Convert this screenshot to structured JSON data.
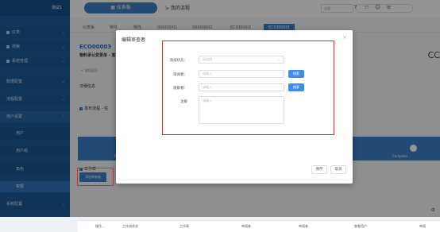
{
  "sidebar": {
    "brand": "测试1",
    "items": [
      {
        "label": "仪表",
        "type": "top"
      },
      {
        "label": "搜索",
        "type": "top"
      },
      {
        "label": "系统管理",
        "type": "top"
      },
      {
        "label": "数据配置",
        "type": "top"
      },
      {
        "label": "流程配置",
        "type": "top"
      },
      {
        "label": "用户设置",
        "type": "active-parent"
      },
      {
        "label": "用户",
        "type": "sub"
      },
      {
        "label": "用户组",
        "type": "sub"
      },
      {
        "label": "角色",
        "type": "sub"
      },
      {
        "label": "权限",
        "type": "sub-active"
      },
      {
        "label": "系统配置",
        "type": "top"
      }
    ]
  },
  "topbar": {
    "main_button": "仪表板",
    "title": "我的流程",
    "select_value": "全部"
  },
  "tabs": [
    {
      "label": "仪表板",
      "active": false
    },
    {
      "label": "特性",
      "active": false
    },
    {
      "label": "特性",
      "active": false
    },
    {
      "label": "00000001",
      "active": false
    },
    {
      "label": "00000002",
      "active": false
    },
    {
      "label": "ECO00001",
      "active": false
    },
    {
      "label": "ECO00003",
      "active": true
    }
  ],
  "page": {
    "eco_title": "ECO00003",
    "eco_subtitle": "物料承认变更单 - 客",
    "cc_text": "CC",
    "pending_label": "< 流程返回",
    "desc_row": "详细信息",
    "workflow_label": "发布流程 - 任",
    "step_left": "Pe",
    "step_right": "Complete",
    "attachment_label": "工作表",
    "add_reviewer_button": "添加审查者"
  },
  "grid": {
    "headers": [
      "操作...",
      "工作流状态",
      "工作表",
      "审阅者",
      "审阅者",
      "查看用户",
      "审阅"
    ]
  },
  "modal": {
    "title": "编辑审查者",
    "fields": {
      "status_label": "添加状态：",
      "status_placeholder": "请选择",
      "reviewer_label": "审阅者：",
      "reviewer_placeholder": "请输入",
      "reviewer_search": "搜索",
      "observer_label": "观察者：",
      "observer_placeholder": "请输入",
      "observer_search": "搜索",
      "note_label": "注解",
      "note_placeholder": "请输入"
    },
    "save_button": "保存",
    "cancel_button": "取消"
  }
}
